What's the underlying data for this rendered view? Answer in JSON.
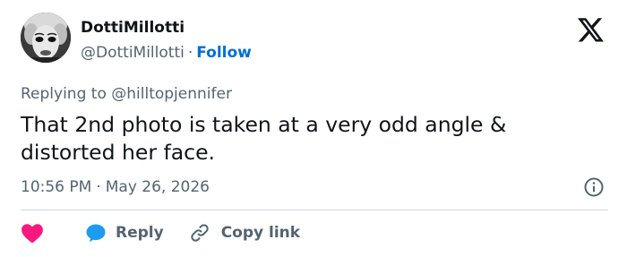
{
  "author": {
    "display_name": "DottiMillotti",
    "handle": "@DottiMillotti",
    "separator": "·",
    "follow_label": "Follow"
  },
  "tweet": {
    "replying_prefix": "Replying to",
    "replying_to": "@hilltopjennifer",
    "text": "That 2nd photo is taken at a very odd angle & distorted her face.",
    "time": "10:56 PM",
    "separator": "·",
    "date": "May 26, 2026"
  },
  "actions": {
    "reply_label": "Reply",
    "copy_link_label": "Copy link"
  },
  "icons": {
    "brand": "x-logo-icon",
    "info": "info-icon",
    "like": "heart-icon",
    "reply": "speech-bubble-icon",
    "copy": "link-icon"
  },
  "colors": {
    "text_primary": "#0f1419",
    "text_secondary": "#536471",
    "link_blue": "#006fd6",
    "heart_pink": "#f91880",
    "reply_blue": "#1d9bf0",
    "divider": "#cfd9de"
  }
}
